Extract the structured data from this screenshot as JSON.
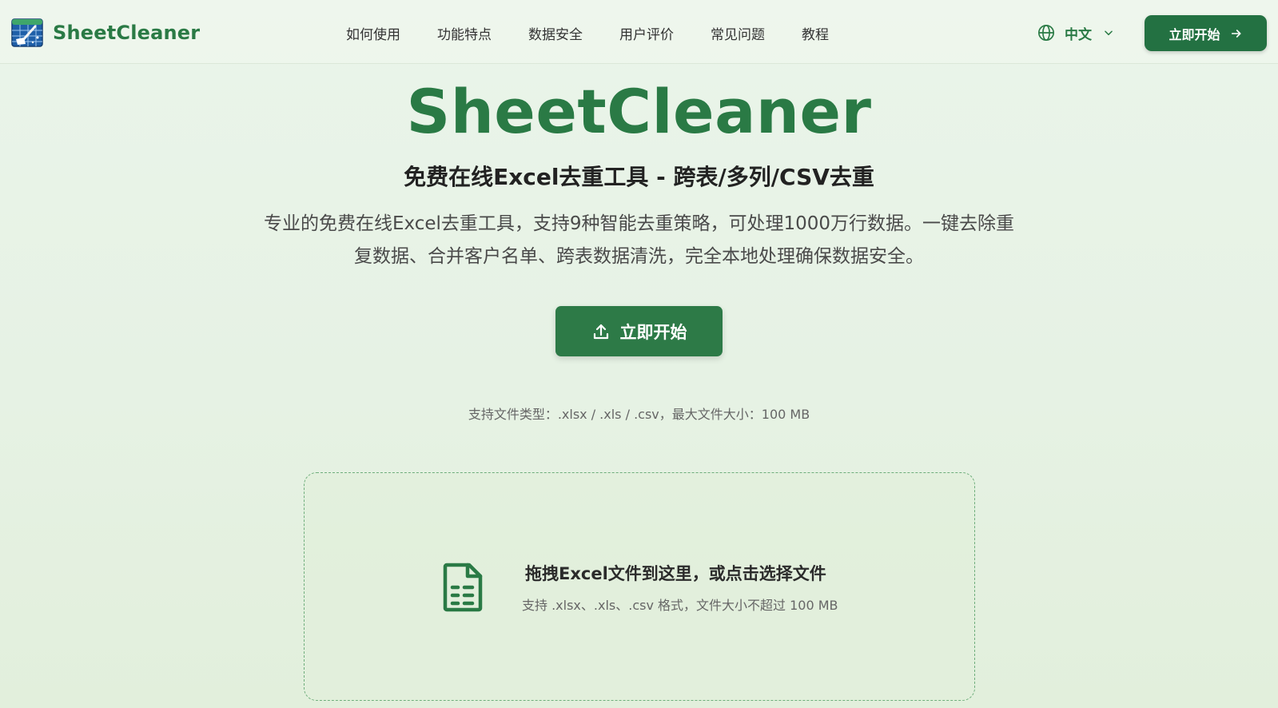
{
  "header": {
    "logo_text": "SheetCleaner",
    "nav": [
      "如何使用",
      "功能特点",
      "数据安全",
      "用户评价",
      "常见问题",
      "教程"
    ],
    "language": "中文",
    "cta_label": "立即开始"
  },
  "hero": {
    "title": "SheetCleaner",
    "subtitle": "免费在线Excel去重工具 - 跨表/多列/CSV去重",
    "description": "专业的免费在线Excel去重工具，支持9种智能去重策略，可处理1000万行数据。一键去除重复数据、合并客户名单、跨表数据清洗，完全本地处理确保数据安全。",
    "cta_label": "立即开始",
    "support_note": "支持文件类型：.xlsx / .xls / .csv，最大文件大小：100 MB"
  },
  "dropzone": {
    "title": "拖拽Excel文件到这里，或点击选择文件",
    "subtitle": "支持 .xlsx、.xls、.csv 格式，文件大小不超过 100 MB"
  },
  "icons": {
    "logo": "spreadsheet-broom-logo-icon",
    "language": "globe-icon",
    "dropdown": "chevron-down-icon",
    "top_cta": "arrow-right-icon",
    "hero_cta": "upload-icon",
    "dropzone": "spreadsheet-file-icon"
  },
  "colors": {
    "brand_green": "#2a7a45",
    "button_green": "#237142",
    "background": "#e6f2e4"
  }
}
